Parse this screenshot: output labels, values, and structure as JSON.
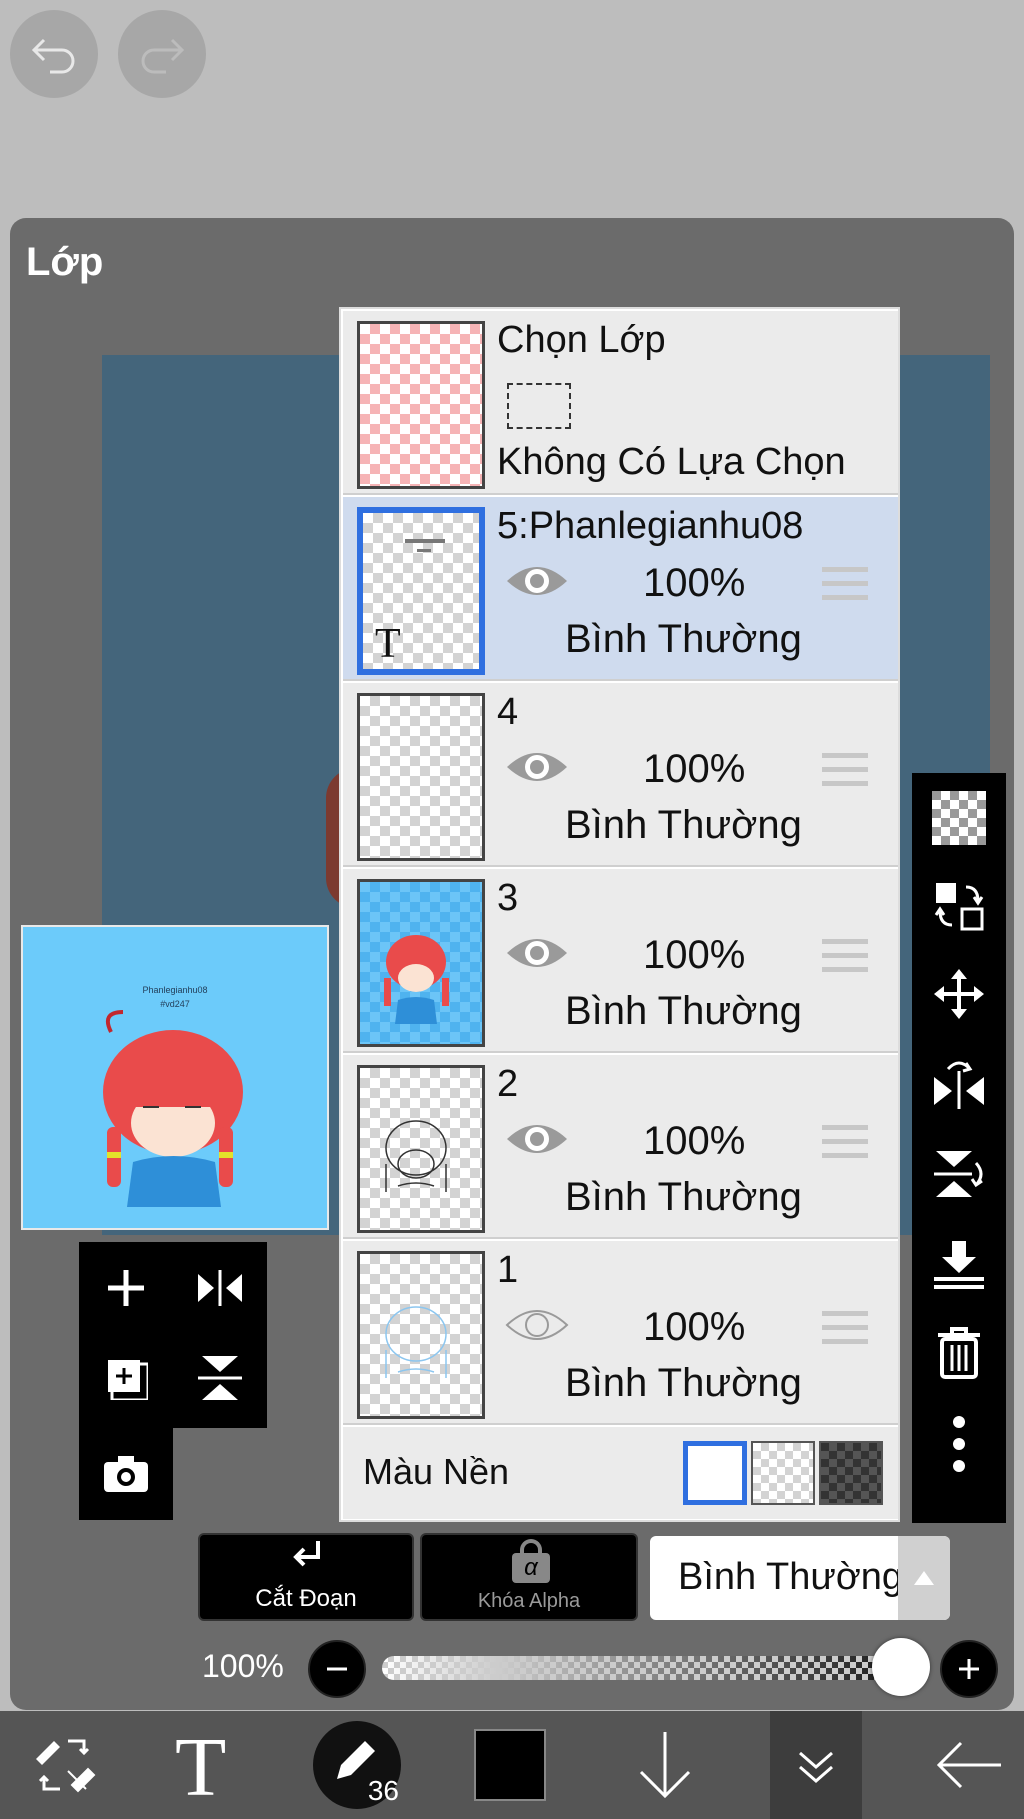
{
  "panel": {
    "title": "Lớp"
  },
  "preview": {
    "line1": "Phanlegianhu08",
    "line2": "#vd247"
  },
  "selection_row": {
    "title": "Chọn Lớp",
    "subtitle": "Không Có Lựa Chọn"
  },
  "layers": [
    {
      "name": "5:Phanlegianhu08",
      "opacity": "100%",
      "blend": "Bình Thường",
      "visible": true,
      "selected": true
    },
    {
      "name": "4",
      "opacity": "100%",
      "blend": "Bình Thường",
      "visible": true,
      "selected": false
    },
    {
      "name": "3",
      "opacity": "100%",
      "blend": "Bình Thường",
      "visible": true,
      "selected": false
    },
    {
      "name": "2",
      "opacity": "100%",
      "blend": "Bình Thường",
      "visible": true,
      "selected": false
    },
    {
      "name": "1",
      "opacity": "100%",
      "blend": "Bình Thường",
      "visible": false,
      "selected": false
    }
  ],
  "background": {
    "label": "Màu Nền",
    "options": [
      "white",
      "transparent",
      "dark-checker"
    ],
    "selected": "white"
  },
  "actions": {
    "clip_label": "Cắt Đoạn",
    "alpha_lock_label": "Khóa Alpha",
    "alpha_glyph": "α"
  },
  "blend_mode": {
    "value": "Bình Thường"
  },
  "opacity": {
    "label": "100%",
    "value": 1.0
  },
  "brush": {
    "size": "36"
  },
  "colors": {
    "accent": "#2f6fe0",
    "panel": "#6b6b6b",
    "canvas": "#44657b",
    "preview_bg": "#6ccbfa",
    "selected_row": "#cfdbee"
  }
}
